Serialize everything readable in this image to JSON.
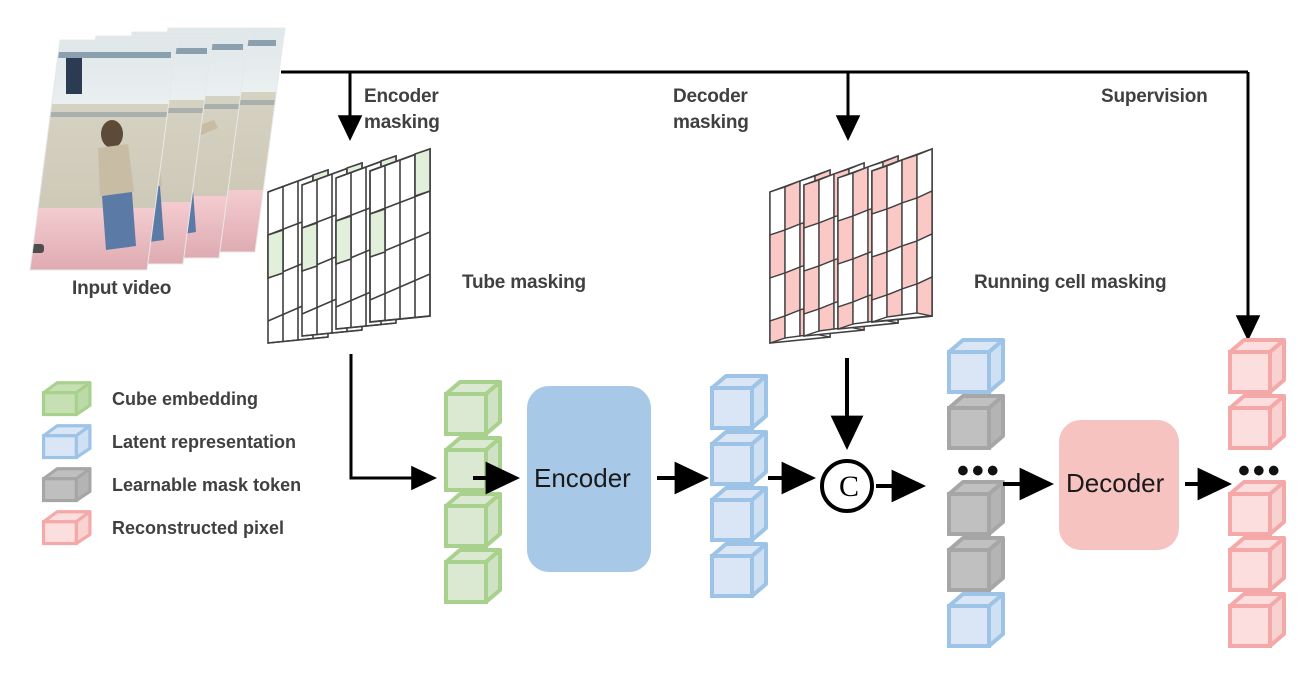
{
  "diagram": {
    "title": "Masked video autoencoder with tube and running cell masking",
    "labels": {
      "input_video": "Input video",
      "encoder_masking": "Encoder\nmasking",
      "encoder_masking_l1": "Encoder",
      "encoder_masking_l2": "masking",
      "decoder_masking_l1": "Decoder",
      "decoder_masking_l2": "masking",
      "supervision": "Supervision",
      "tube_masking": "Tube masking",
      "running_cell_masking": "Running cell masking",
      "encoder": "Encoder",
      "decoder": "Decoder",
      "concat_symbol": "C",
      "ellipsis_mid": "•••",
      "ellipsis_out": "•••"
    },
    "legend": [
      {
        "name": "cube-embedding",
        "label": "Cube embedding",
        "color": "#c6e0b4",
        "stroke": "#a9d18e"
      },
      {
        "name": "latent-representation",
        "label": "Latent representation",
        "color": "#dae6f5",
        "stroke": "#9dc3e6"
      },
      {
        "name": "learnable-mask-token",
        "label": "Learnable mask token",
        "color": "#bfbfbf",
        "stroke": "#a6a6a6"
      },
      {
        "name": "reconstructed-pixel",
        "label": "Reconstructed pixel",
        "color": "#fbdedd",
        "stroke": "#f4a9a8"
      }
    ],
    "colors": {
      "green_fill": "#dbe9d2",
      "green_stroke": "#a9d18e",
      "blue_fill": "#dae6f5",
      "blue_stroke": "#9dc3e6",
      "gray_fill": "#c0c0c0",
      "gray_stroke": "#a6a6a6",
      "pink_fill": "#fbdedd",
      "pink_stroke": "#f4a9a8",
      "encoder_block": "#a8c8e8",
      "decoder_block": "#f6c3c1",
      "mask_green_cell": "#e2efda",
      "mask_pink_cell": "#fac9c6",
      "line": "#000000",
      "text": "#404040"
    },
    "columns": {
      "cube_embedding_count": 4,
      "latent_count": 4,
      "mixed_tokens": [
        "latent",
        "mask",
        "ellipsis",
        "mask",
        "mask",
        "latent"
      ],
      "output_tokens": [
        "pixel",
        "pixel",
        "ellipsis",
        "pixel",
        "pixel",
        "pixel"
      ]
    },
    "tube_masking": {
      "planes": 4,
      "rows": 4,
      "cols": 4,
      "masked_cells": [
        [
          0,
          3
        ],
        [
          1,
          0
        ]
      ]
    },
    "running_cell_masking": {
      "planes": 4,
      "rows": 4,
      "cols": 4,
      "pattern": "checkerboard-shifting"
    }
  }
}
